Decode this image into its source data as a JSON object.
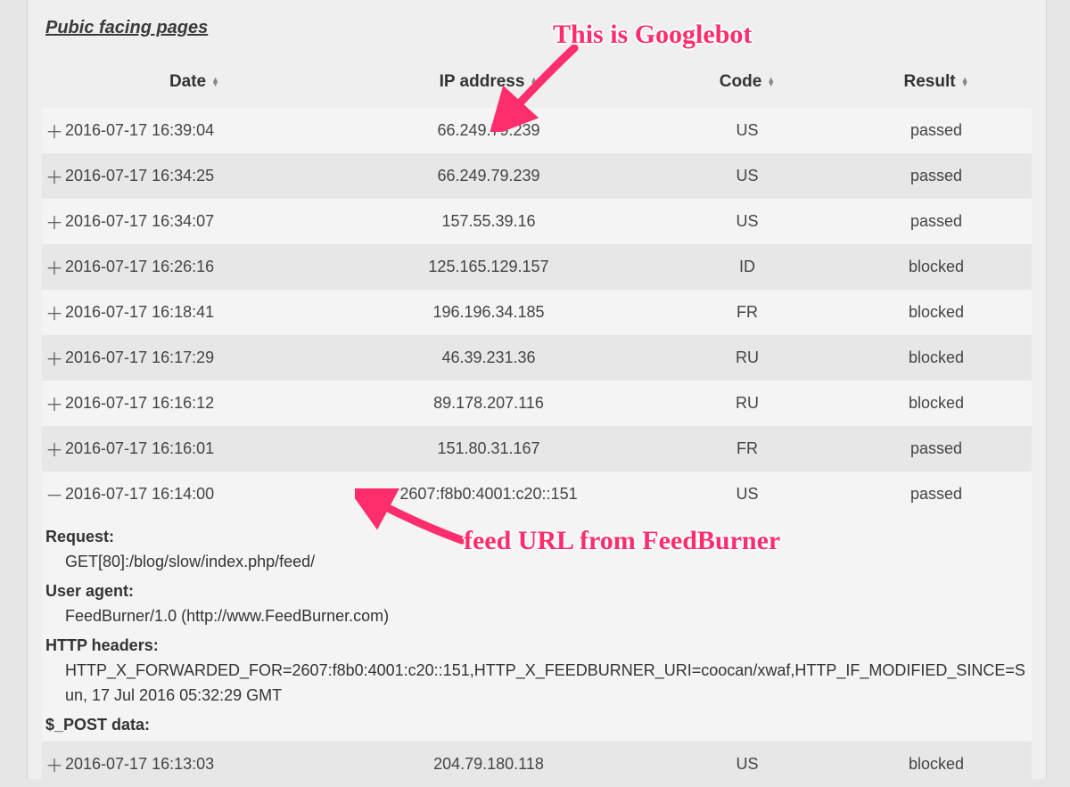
{
  "section_title": "Pubic facing pages",
  "columns": {
    "date": "Date",
    "ip": "IP address",
    "code": "Code",
    "result": "Result"
  },
  "rows": [
    {
      "expanded": false,
      "date": "2016-07-17 16:39:04",
      "ip": "66.249.79.239",
      "code": "US",
      "result": "passed"
    },
    {
      "expanded": false,
      "date": "2016-07-17 16:34:25",
      "ip": "66.249.79.239",
      "code": "US",
      "result": "passed"
    },
    {
      "expanded": false,
      "date": "2016-07-17 16:34:07",
      "ip": "157.55.39.16",
      "code": "US",
      "result": "passed"
    },
    {
      "expanded": false,
      "date": "2016-07-17 16:26:16",
      "ip": "125.165.129.157",
      "code": "ID",
      "result": "blocked"
    },
    {
      "expanded": false,
      "date": "2016-07-17 16:18:41",
      "ip": "196.196.34.185",
      "code": "FR",
      "result": "blocked"
    },
    {
      "expanded": false,
      "date": "2016-07-17 16:17:29",
      "ip": "46.39.231.36",
      "code": "RU",
      "result": "blocked"
    },
    {
      "expanded": false,
      "date": "2016-07-17 16:16:12",
      "ip": "89.178.207.116",
      "code": "RU",
      "result": "blocked"
    },
    {
      "expanded": false,
      "date": "2016-07-17 16:16:01",
      "ip": "151.80.31.167",
      "code": "FR",
      "result": "passed"
    },
    {
      "expanded": true,
      "date": "2016-07-17 16:14:00",
      "ip": "2607:f8b0:4001:c20::151",
      "code": "US",
      "result": "passed"
    },
    {
      "expanded": false,
      "date": "2016-07-17 16:13:03",
      "ip": "204.79.180.118",
      "code": "US",
      "result": "blocked"
    }
  ],
  "details": {
    "request_label": "Request:",
    "request_value": "GET[80]:/blog/slow/index.php/feed/",
    "ua_label": "User agent:",
    "ua_value": "FeedBurner/1.0 (http://www.FeedBurner.com)",
    "headers_label": "HTTP headers:",
    "headers_value": "HTTP_X_FORWARDED_FOR=2607:f8b0:4001:c20::151,HTTP_X_FEEDBURNER_URI=coocan/xwaf,HTTP_IF_MODIFIED_SINCE=Sun, 17 Jul 2016 05:32:29 GMT",
    "post_label": "$_POST data:"
  },
  "annotations": {
    "top": "This is Googlebot",
    "mid": "feed URL from FeedBurner"
  },
  "glyphs": {
    "plus": "＋",
    "minus": "－",
    "up": "▲",
    "down": "▼"
  },
  "colors": {
    "annotation": "#ff2d6b"
  }
}
